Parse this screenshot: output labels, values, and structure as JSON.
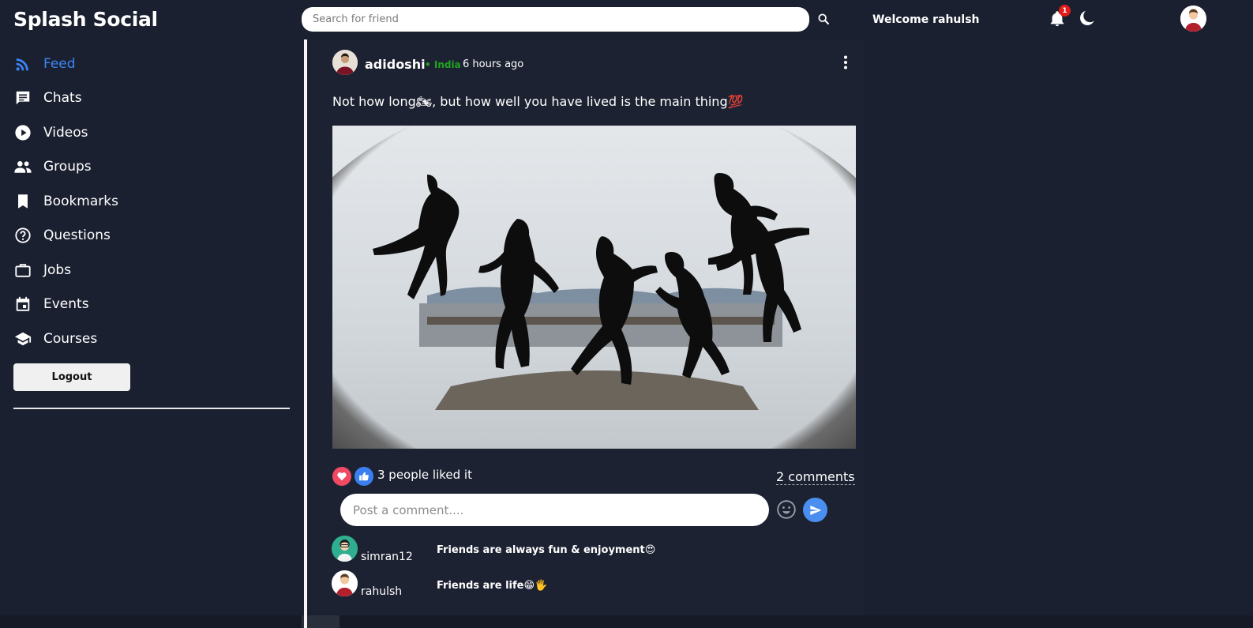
{
  "app": {
    "brand": "Splash Social"
  },
  "header": {
    "search_placeholder": "Search for friend",
    "welcome": "Welcome rahulsh",
    "notification_count": "1"
  },
  "sidebar": {
    "items": [
      {
        "label": "Feed",
        "icon": "rss-icon",
        "active": true
      },
      {
        "label": "Chats",
        "icon": "chat-icon"
      },
      {
        "label": "Videos",
        "icon": "play-circle-icon"
      },
      {
        "label": "Groups",
        "icon": "group-icon"
      },
      {
        "label": "Bookmarks",
        "icon": "bookmark-icon"
      },
      {
        "label": "Questions",
        "icon": "help-circle-icon"
      },
      {
        "label": "Jobs",
        "icon": "briefcase-icon"
      },
      {
        "label": "Events",
        "icon": "calendar-icon"
      },
      {
        "label": "Courses",
        "icon": "school-icon"
      }
    ],
    "logout_label": "Logout"
  },
  "post": {
    "username": "adidoshi",
    "location": "• India",
    "time": "6 hours ago",
    "text": "Not how long🏍, but how well you have lived is the main thing💯",
    "likes_text": "3 people liked it",
    "comments_link": "2 comments",
    "comment_placeholder": "Post a comment....",
    "comments": [
      {
        "user": "simran12",
        "text": "Friends are always fun & enjoyment😍"
      },
      {
        "user": "rahulsh",
        "text": "Friends are life😁🖐"
      }
    ]
  },
  "colors": {
    "background": "#1b2030",
    "accent": "#3a86f3",
    "location": "#1fa51f",
    "heart": "#f04a63",
    "badge": "#e21b1b"
  }
}
